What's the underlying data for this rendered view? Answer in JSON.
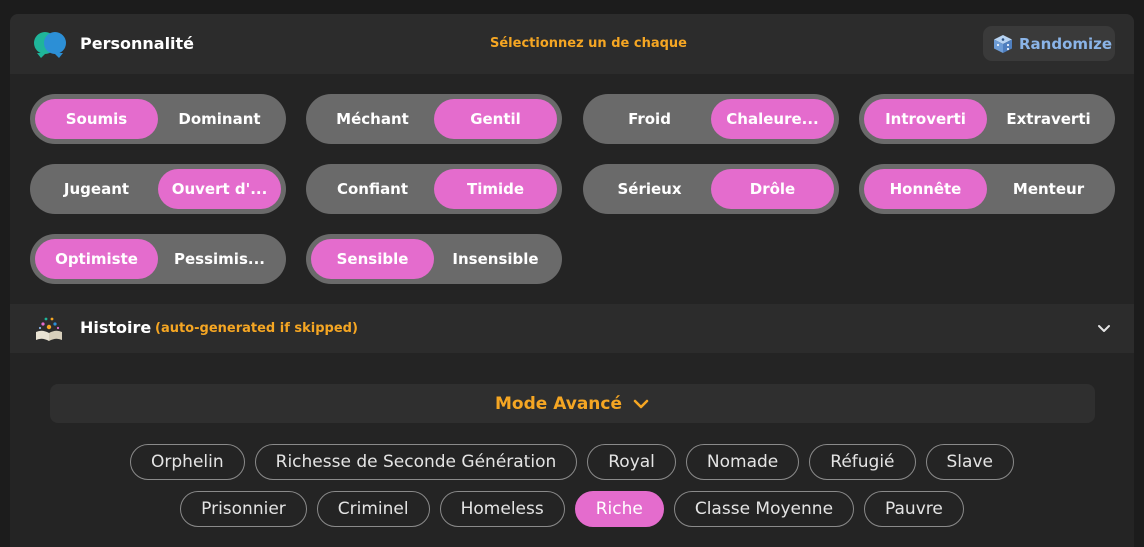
{
  "personality": {
    "title": "Personnalité",
    "hint": "Sélectionnez un de chaque",
    "randomize_label": "Randomize",
    "accent_color": "#e46ccd",
    "toggles": [
      {
        "options": [
          "Soumis",
          "Dominant"
        ],
        "selected": 0
      },
      {
        "options": [
          "Méchant",
          "Gentil"
        ],
        "selected": 1
      },
      {
        "options": [
          "Froid",
          "Chaleure..."
        ],
        "selected": 1
      },
      {
        "options": [
          "Introverti",
          "Extraverti"
        ],
        "selected": 0
      },
      {
        "options": [
          "Jugeant",
          "Ouvert d'..."
        ],
        "selected": 1
      },
      {
        "options": [
          "Confiant",
          "Timide"
        ],
        "selected": 1
      },
      {
        "options": [
          "Sérieux",
          "Drôle"
        ],
        "selected": 1
      },
      {
        "options": [
          "Honnête",
          "Menteur"
        ],
        "selected": 0
      },
      {
        "options": [
          "Optimiste",
          "Pessimis..."
        ],
        "selected": 0
      },
      {
        "options": [
          "Sensible",
          "Insensible"
        ],
        "selected": 0
      }
    ]
  },
  "histoire": {
    "title": "Histoire",
    "subtitle": "(auto-generated if skipped)"
  },
  "advanced": {
    "label": "Mode Avancé"
  },
  "backgrounds": {
    "rows": [
      [
        "Orphelin",
        "Richesse de Seconde Génération",
        "Royal",
        "Nomade",
        "Réfugié",
        "Slave"
      ],
      [
        "Prisonnier",
        "Criminel",
        "Homeless",
        "Riche",
        "Classe Moyenne",
        "Pauvre"
      ]
    ],
    "selected": "Riche"
  }
}
